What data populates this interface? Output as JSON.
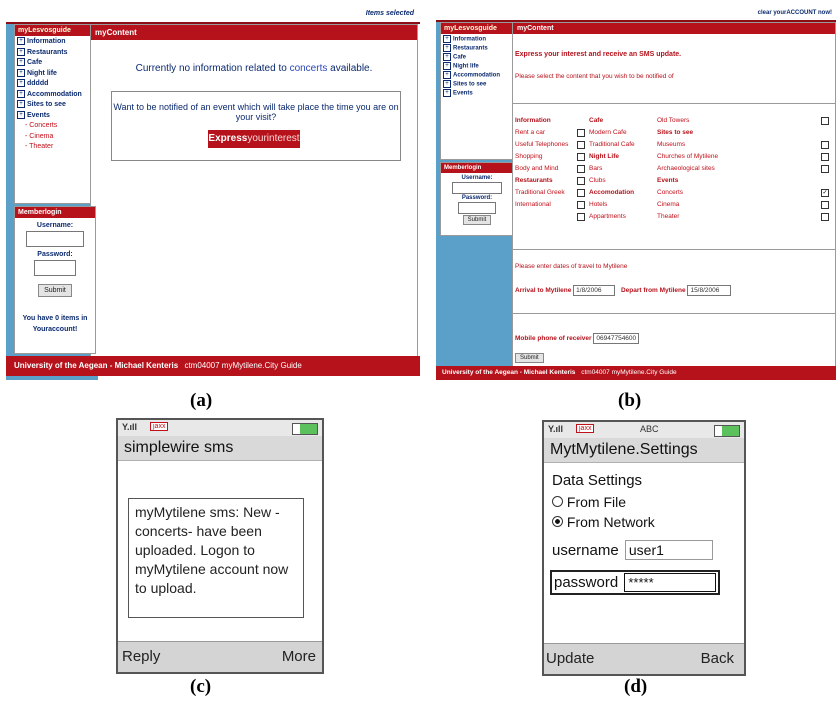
{
  "captions": [
    "(a)",
    "(b)",
    "(c)",
    "(d)"
  ],
  "colors": {
    "brand_red": "#b5121b",
    "side_blue": "#5aa0c8",
    "link_blue": "#0b2a6e"
  },
  "screen_a": {
    "top_right": "Items selected",
    "nav_title": "myLesvosguide",
    "nav_items": [
      "Information",
      "Restaurants",
      "Cafe",
      "Night life",
      "ddddd",
      "Accommodation",
      "Sites to see",
      "Events"
    ],
    "nav_sub_items": [
      "Concerts",
      "Cinema",
      "Theater"
    ],
    "content_title": "myContent",
    "no_info_pre": "Currently no information related to",
    "no_info_link": "concerts",
    "no_info_post": "available.",
    "question": "Want to be notified of an event which will take place the time you are on your visit?",
    "express_bold": "Express",
    "express_rest": "yourinterest",
    "login_title": "Memberlogin",
    "username_label": "Username:",
    "password_label": "Password:",
    "submit": "Submit",
    "items_line1": "You have 0 items in",
    "items_line2": "Youraccount!",
    "footer_bold": "University of the Aegean - Michael Kenteris",
    "footer_rest": "ctm04007 myMytilene.City Guide"
  },
  "screen_b": {
    "top_right": "clear yourACCOUNT now!",
    "nav_title": "myLesvosguide",
    "nav_items": [
      "Information",
      "Restaurants",
      "Cafe",
      "Night life",
      "Accommodation",
      "Sites to see",
      "Events"
    ],
    "content_title": "myContent",
    "heading": "Express your interest and receive an SMS update.",
    "instruction": "Please select the content that you wish to be notified of",
    "col1": [
      {
        "label": "Information",
        "head": true
      },
      {
        "label": "Rent a car"
      },
      {
        "label": "Useful Telephones"
      },
      {
        "label": "Shopping"
      },
      {
        "label": "Body and Mind"
      },
      {
        "label": "Restaurants",
        "head": true
      },
      {
        "label": "Traditional Greek"
      },
      {
        "label": "International"
      }
    ],
    "col2": [
      {
        "label": "Cafe",
        "head": true
      },
      {
        "label": "Modern Cafe"
      },
      {
        "label": "Traditional Cafe"
      },
      {
        "label": "Night Life",
        "head": true
      },
      {
        "label": "Bars"
      },
      {
        "label": "Clubs"
      },
      {
        "label": "Accomodation",
        "head": true
      },
      {
        "label": "Hotels"
      },
      {
        "label": "Appartments"
      }
    ],
    "col3": [
      {
        "label": "Old Towers"
      },
      {
        "label": "Sites to see",
        "head": true
      },
      {
        "label": "Museums"
      },
      {
        "label": "Churches of Mytilene"
      },
      {
        "label": "Archaeological sites"
      },
      {
        "label": "Events",
        "head": true
      },
      {
        "label": "Concerts",
        "checked": true
      },
      {
        "label": "Cinema"
      },
      {
        "label": "Theater"
      }
    ],
    "dates_prompt": "Please enter dates of travel to Mytilene",
    "arrival_label": "Arrival to Mytilene",
    "arrival_value": "1/8/2006",
    "depart_label": "Depart from Mytilene",
    "depart_value": "15/8/2006",
    "mobile_label": "Mobile phone of receiver",
    "mobile_value": "06947754600",
    "submit": "Submit",
    "login_title": "Memberlogin",
    "username_label": "Username:",
    "password_label": "Password:",
    "footer_bold": "University of the Aegean - Michael Kenteris",
    "footer_rest": "ctm04007 myMytilene.City Guide"
  },
  "phone_c": {
    "status_badge": "jaxx",
    "title": "simplewire sms",
    "message": "myMytilene sms: New -concerts- have been uploaded. Logon to myMytilene account now to upload.",
    "soft_left": "Reply",
    "soft_right": "More"
  },
  "phone_d": {
    "status_badge": "jaxx",
    "input_mode": "ABC",
    "title": "MytMytilene.Settings",
    "section": "Data Settings",
    "option_file": "From File",
    "option_network": "From Network",
    "username_label": "username",
    "username_value": "user1",
    "password_label": "password",
    "password_value": "*****",
    "soft_left": "Update",
    "soft_right": "Back"
  }
}
